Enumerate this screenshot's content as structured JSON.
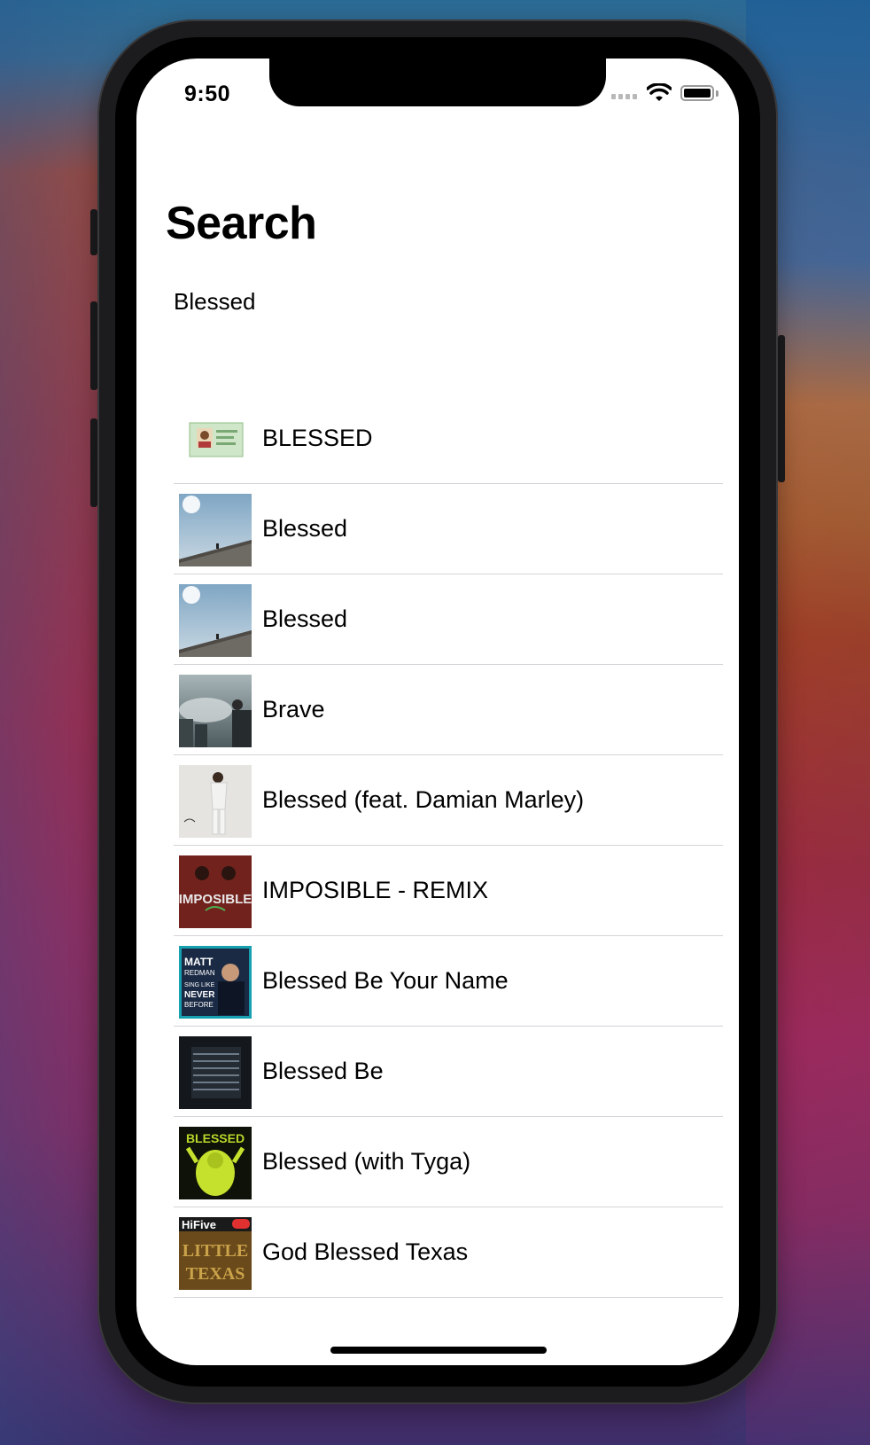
{
  "status_bar": {
    "time": "9:50"
  },
  "page": {
    "title": "Search"
  },
  "search": {
    "value": "Blessed"
  },
  "results": [
    {
      "title": "BLESSED",
      "art": "album-art-id-card"
    },
    {
      "title": "Blessed",
      "art": "album-art-sky-building"
    },
    {
      "title": "Blessed",
      "art": "album-art-sky-building"
    },
    {
      "title": "Brave",
      "art": "album-art-city-clouds"
    },
    {
      "title": "Blessed (feat. Damian Marley)",
      "art": "album-art-standing-figure"
    },
    {
      "title": "IMPOSIBLE - REMIX",
      "art": "album-art-imposible",
      "art_text": "IMPOSIBLE"
    },
    {
      "title": "Blessed Be Your Name",
      "art": "album-art-matt-redman",
      "art_text": "MATT REDMAN SING LIKE NEVER BEFORE"
    },
    {
      "title": "Blessed Be",
      "art": "album-art-dark-grid"
    },
    {
      "title": "Blessed (with Tyga)",
      "art": "album-art-yellow-green",
      "art_text": "BLESSED"
    },
    {
      "title": "God Blessed Texas",
      "art": "album-art-little-texas",
      "art_text": "HiFive LITTLE TEXAS"
    }
  ],
  "colors": {
    "separator": "#d4d4d8",
    "text": "#000000",
    "background": "#ffffff"
  }
}
